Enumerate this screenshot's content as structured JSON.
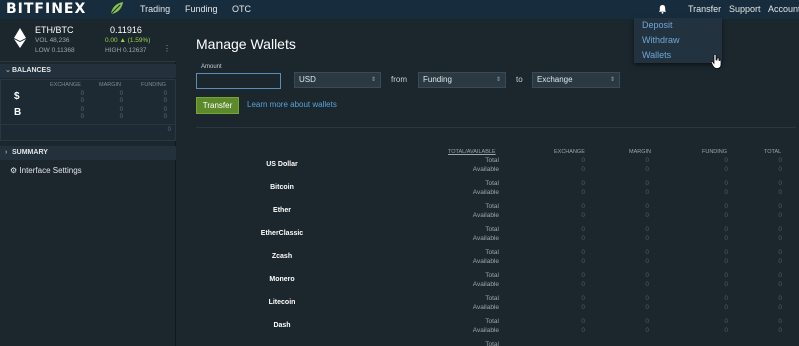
{
  "nav": {
    "logo": "BITFINEX",
    "links": [
      "Trading",
      "Funding",
      "OTC"
    ],
    "right_links": [
      "Transfer",
      "Support",
      "Account"
    ]
  },
  "dropdown": {
    "items": [
      "Deposit",
      "Withdraw",
      "Wallets"
    ]
  },
  "ticker": {
    "symbol": "ETH/BTC",
    "price": "0.11916",
    "vol": "VOL 48,236",
    "change": "0.00 ▲ (1.59%)",
    "low": "LOW 0.11368",
    "high": "HIGH 0.12637"
  },
  "balances": {
    "title": "BALANCES",
    "headers": [
      "EXCHANGE",
      "MARGIN",
      "FUNDING"
    ],
    "rows": [
      {
        "symbol": "$",
        "values": [
          "0",
          "0",
          "0",
          "0"
        ]
      },
      {
        "symbol": "B",
        "values": [
          "0",
          "0",
          "0",
          "0"
        ]
      }
    ],
    "total": "0"
  },
  "summary": {
    "title": "SUMMARY"
  },
  "settings": {
    "label": "Interface Settings"
  },
  "main": {
    "title": "Manage Wallets",
    "amount_label": "Amount",
    "amount_value": "",
    "currency": "USD",
    "from_label": "from",
    "from_value": "Funding",
    "to_label": "to",
    "to_value": "Exchange",
    "transfer_button": "Transfer",
    "learn_link": "Learn more about wallets"
  },
  "wallets_table": {
    "headers": [
      "TOTAL/AVAILABLE",
      "EXCHANGE",
      "MARGIN",
      "FUNDING",
      "TOTAL"
    ],
    "sub_labels": [
      "Total",
      "Available"
    ],
    "rows": [
      {
        "name": "US Dollar",
        "values": [
          "0",
          "0",
          "0",
          "0",
          "0",
          "0",
          "0",
          "0"
        ]
      },
      {
        "name": "Bitcoin",
        "values": [
          "0",
          "0",
          "0",
          "0",
          "0",
          "0",
          "0",
          "0"
        ]
      },
      {
        "name": "Ether",
        "values": [
          "0",
          "0",
          "0",
          "0",
          "0",
          "0",
          "0",
          "0"
        ]
      },
      {
        "name": "EtherClassic",
        "values": [
          "0",
          "0",
          "0",
          "0",
          "0",
          "0",
          "0",
          "0"
        ]
      },
      {
        "name": "Zcash",
        "values": [
          "0",
          "0",
          "0",
          "0",
          "0",
          "0",
          "0",
          "0"
        ]
      },
      {
        "name": "Monero",
        "values": [
          "0",
          "0",
          "0",
          "0",
          "0",
          "0",
          "0",
          "0"
        ]
      },
      {
        "name": "Litecoin",
        "values": [
          "0",
          "0",
          "0",
          "0",
          "0",
          "0",
          "0",
          "0"
        ]
      },
      {
        "name": "Dash",
        "values": [
          "0",
          "0",
          "0",
          "0",
          "0",
          "0",
          "0",
          "0"
        ]
      }
    ],
    "partial_row_label": "Total"
  },
  "colors": {
    "nav_bg": "#172d3e",
    "page_bg": "#1b262d",
    "accent_green": "#5c8a2b",
    "link_blue": "#5aa3d8"
  }
}
